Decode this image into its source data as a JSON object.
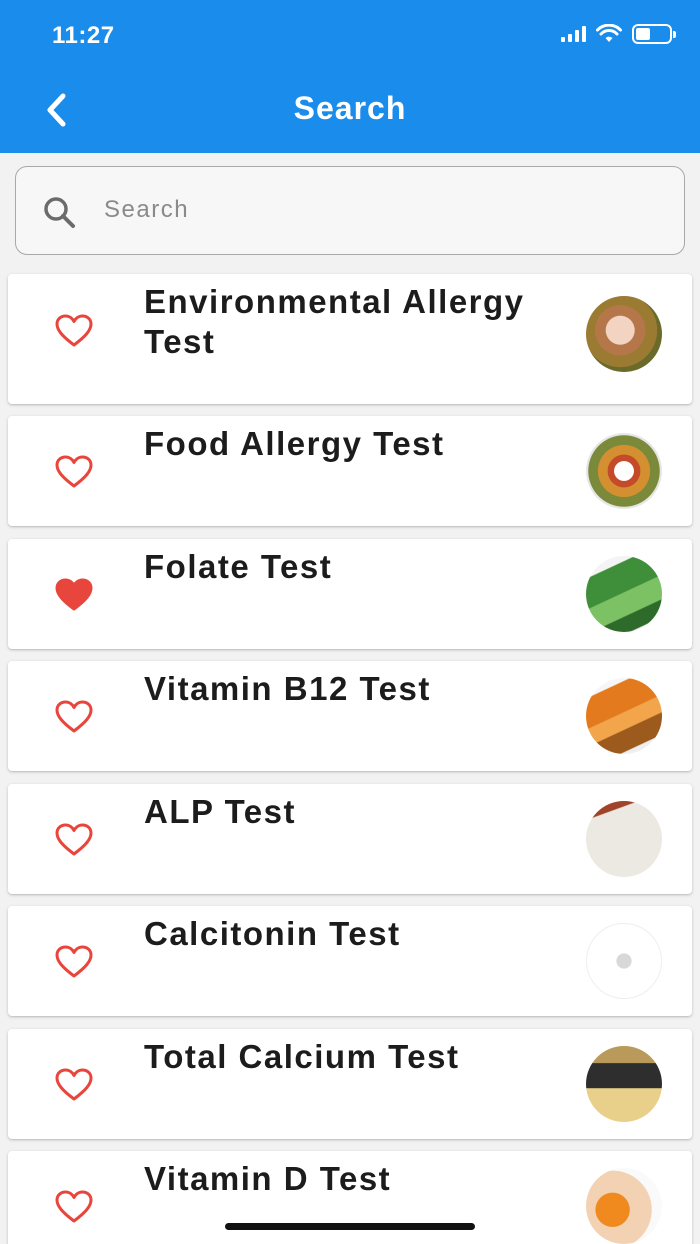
{
  "status_bar": {
    "time": "11:27"
  },
  "header": {
    "title": "Search"
  },
  "search": {
    "placeholder": "Search",
    "value": ""
  },
  "accent_color": "#1a8cec",
  "heart_color": "#e8463c",
  "tests": [
    {
      "name": "Environmental Allergy Test",
      "favorite": false
    },
    {
      "name": "Food Allergy Test",
      "favorite": false
    },
    {
      "name": "Folate Test",
      "favorite": true
    },
    {
      "name": "Vitamin B12 Test",
      "favorite": false
    },
    {
      "name": "ALP Test",
      "favorite": false
    },
    {
      "name": "Calcitonin Test",
      "favorite": false
    },
    {
      "name": "Total Calcium Test",
      "favorite": false
    },
    {
      "name": "Vitamin D Test",
      "favorite": false
    }
  ]
}
